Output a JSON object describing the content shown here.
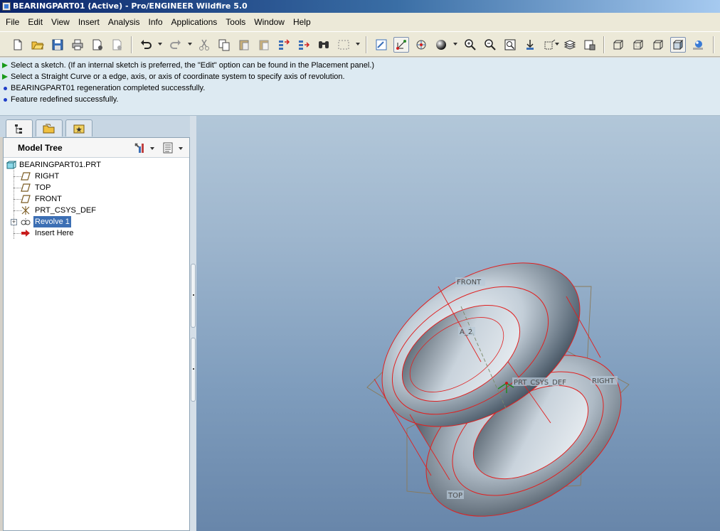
{
  "window": {
    "title": "BEARINGPART01 (Active) - Pro/ENGINEER Wildfire 5.0"
  },
  "menu": [
    "File",
    "Edit",
    "View",
    "Insert",
    "Analysis",
    "Info",
    "Applications",
    "Tools",
    "Window",
    "Help"
  ],
  "toolbar": {
    "icons": [
      "new-icon",
      "open-icon",
      "save-icon",
      "print-icon",
      "send-mail-icon",
      "attach-mail-icon",
      "undo-icon",
      "redo-icon",
      "cut-icon",
      "copy-icon",
      "paste-icon",
      "paste-special-icon",
      "regenerate-icon",
      "regenerate-manager-icon",
      "find-icon",
      "select-box-icon",
      "repaint-icon",
      "spin-center-icon",
      "orient-mode-icon",
      "appearance-icon",
      "zoom-in-icon",
      "zoom-out-icon",
      "refit-icon",
      "reorient-icon",
      "saved-views-icon",
      "layers-icon",
      "view-manager-icon",
      "wireframe-icon",
      "hidden-line-icon",
      "no-hidden-icon",
      "shading-icon",
      "enhanced-realism-icon"
    ],
    "pressed": [
      "spin-center-icon",
      "shading-icon"
    ]
  },
  "messages": [
    {
      "type": "prompt",
      "text": "Select a sketch. (If an internal sketch is preferred, the \"Edit\" option can be found in the Placement panel.)"
    },
    {
      "type": "prompt",
      "text": "Select a  Straight Curve or a edge, axis, or axis of coordinate system to specify axis of revolution."
    },
    {
      "type": "info",
      "text": "BEARINGPART01 regeneration completed successfully."
    },
    {
      "type": "info",
      "text": "Feature redefined successfully."
    }
  ],
  "navigator": {
    "tabs": [
      "model-tree-tab",
      "folder-browser-tab",
      "favorites-tab"
    ],
    "title": "Model Tree",
    "tree": {
      "root": "BEARINGPART01.PRT",
      "items": [
        {
          "label": "RIGHT",
          "icon": "datum-plane-icon"
        },
        {
          "label": "TOP",
          "icon": "datum-plane-icon"
        },
        {
          "label": "FRONT",
          "icon": "datum-plane-icon"
        },
        {
          "label": "PRT_CSYS_DEF",
          "icon": "coordinate-system-icon"
        },
        {
          "label": "Revolve 1",
          "icon": "revolve-icon",
          "selected": true,
          "expandable": true
        },
        {
          "label": "Insert Here",
          "icon": "insert-here-arrow-icon"
        }
      ]
    }
  },
  "graphics": {
    "datum_labels": {
      "front": "FRONT",
      "axis": "A_2",
      "csys": "PRT_CSYS_DEF",
      "right": "RIGHT",
      "top": "TOP"
    },
    "colors": {
      "edge_highlight": "#e02020",
      "datum": "#8a7a5a",
      "background_top": "#b2c7d9",
      "background_bottom": "#6886aa"
    }
  }
}
